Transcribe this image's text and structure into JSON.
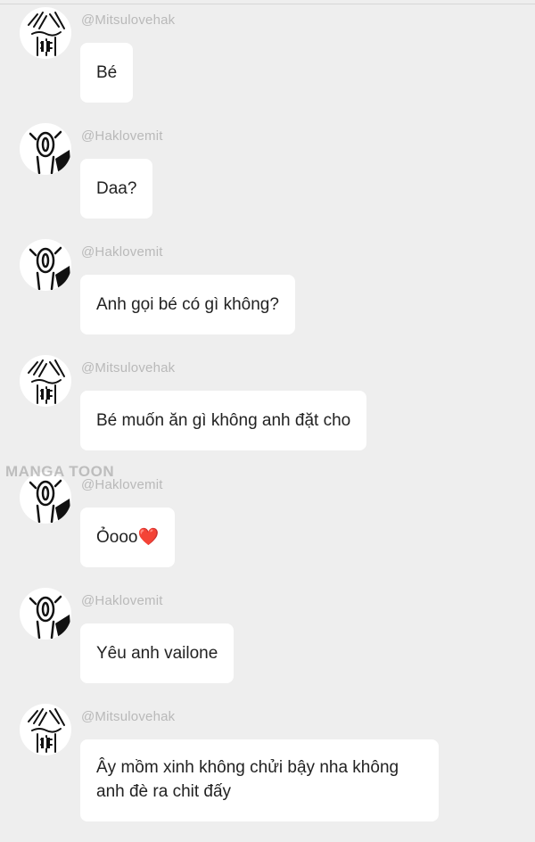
{
  "watermark": "MANGA TOON",
  "messages": [
    {
      "username": "@Mitsulovehak",
      "text": "Bé",
      "avatar": "mitsu-avatar"
    },
    {
      "username": "@Haklovemit",
      "text": "Daa?",
      "avatar": "hak-avatar"
    },
    {
      "username": "@Haklovemit",
      "text": "Anh gọi bé có gì không?",
      "avatar": "hak-avatar"
    },
    {
      "username": "@Mitsulovehak",
      "text": "Bé muốn ăn gì không anh đặt cho",
      "avatar": "mitsu-avatar"
    },
    {
      "username": "@Haklovemit",
      "text": "Ỏooo",
      "emoji": "❤️",
      "avatar": "hak-avatar"
    },
    {
      "username": "@Haklovemit",
      "text": "Yêu anh vailone",
      "avatar": "hak-avatar"
    },
    {
      "username": "@Mitsulovehak",
      "text": "Ây mồm xinh không chửi bậy nha không anh đè ra chit đấy",
      "avatar": "mitsu-avatar"
    }
  ]
}
